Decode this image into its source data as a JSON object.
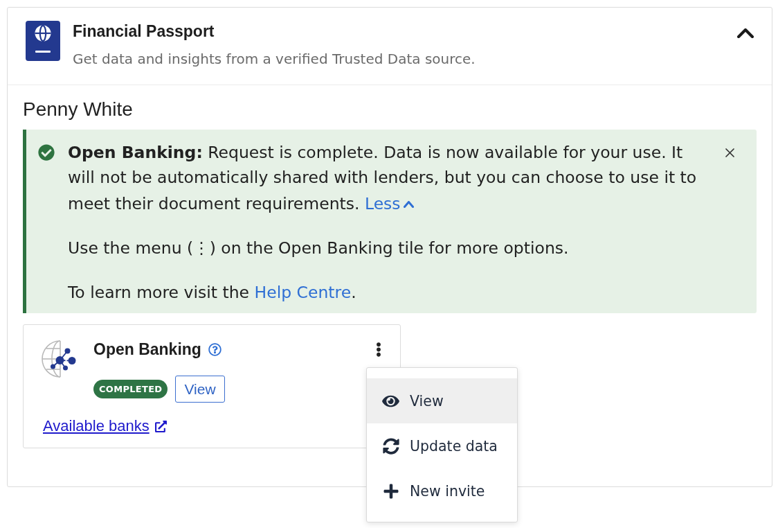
{
  "panel": {
    "title": "Financial Passport",
    "subtitle": "Get data and insights from a verified Trusted Data source.",
    "expanded": true
  },
  "client": {
    "name": "Penny White"
  },
  "alert": {
    "kind": "success",
    "dismissible": true,
    "expanded": true,
    "summary": "**Open Banking:** Request is complete. Data is now available for your use. It will not be automatically shared with lenders, but you can choose to use it to meet their document requirements.",
    "toggle": "Less",
    "details": [
      {
        "text": "Use the menu (⋮) on the Open Banking tile for more options."
      },
      {
        "text": "To learn more visit the",
        "link": "Help Centre",
        "after": "."
      }
    ]
  },
  "tile": {
    "title": "Open Banking",
    "status": {
      "label": "COMPLETED",
      "kind": "success"
    },
    "view_button": "View",
    "link": "Available banks",
    "menu": {
      "open": true,
      "items": [
        {
          "kind": "view",
          "label": "View",
          "highlighted": true
        },
        {
          "kind": "update",
          "label": "Update data",
          "highlighted": false
        },
        {
          "kind": "invite",
          "label": "New invite",
          "highlighted": false
        }
      ]
    }
  }
}
